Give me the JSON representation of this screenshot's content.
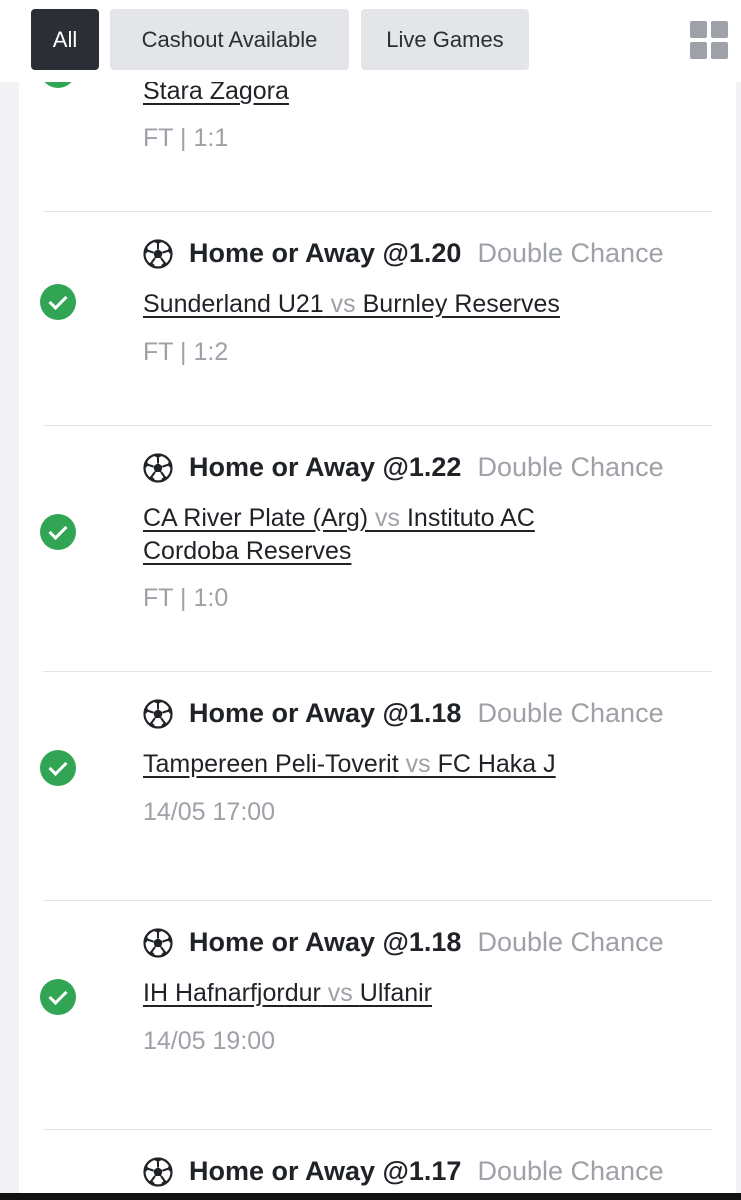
{
  "filters": {
    "all": "All",
    "cashout": "Cashout Available",
    "live": "Live Games"
  },
  "icons": {
    "grid": "grid-view-icon",
    "success": "check-circle-icon",
    "sport": "soccer-ball-icon"
  },
  "colors": {
    "active_filter": "#2b2f35",
    "inactive_filter": "#e4e5e9",
    "success": "#31a553",
    "muted_text": "#9ea1a7"
  },
  "partial_bet": {
    "away_team": "Stara Zagora",
    "status": "FT | 1:1"
  },
  "bets": [
    {
      "selection": "Home or Away @1.20",
      "market": "Double Chance",
      "home_team": "Sunderland U21",
      "vs": " vs ",
      "away_team": "Burnley Reserves",
      "status": "FT | 1:2"
    },
    {
      "selection": "Home or Away @1.22",
      "market": "Double Chance",
      "home_team": "CA River Plate (Arg)",
      "vs": " vs ",
      "away_team": "Instituto AC Cordoba Reserves",
      "status": "FT | 1:0"
    },
    {
      "selection": "Home or Away @1.18",
      "market": "Double Chance",
      "home_team": "Tampereen Peli-Toverit",
      "vs": " vs ",
      "away_team": "FC Haka J",
      "status": "14/05 17:00"
    },
    {
      "selection": "Home or Away @1.18",
      "market": "Double Chance",
      "home_team": "IH Hafnarfjordur",
      "vs": " vs ",
      "away_team": "Ulfanir",
      "status": "14/05 19:00"
    },
    {
      "selection": "Home or Away @1.17",
      "market": "Double Chance"
    }
  ]
}
